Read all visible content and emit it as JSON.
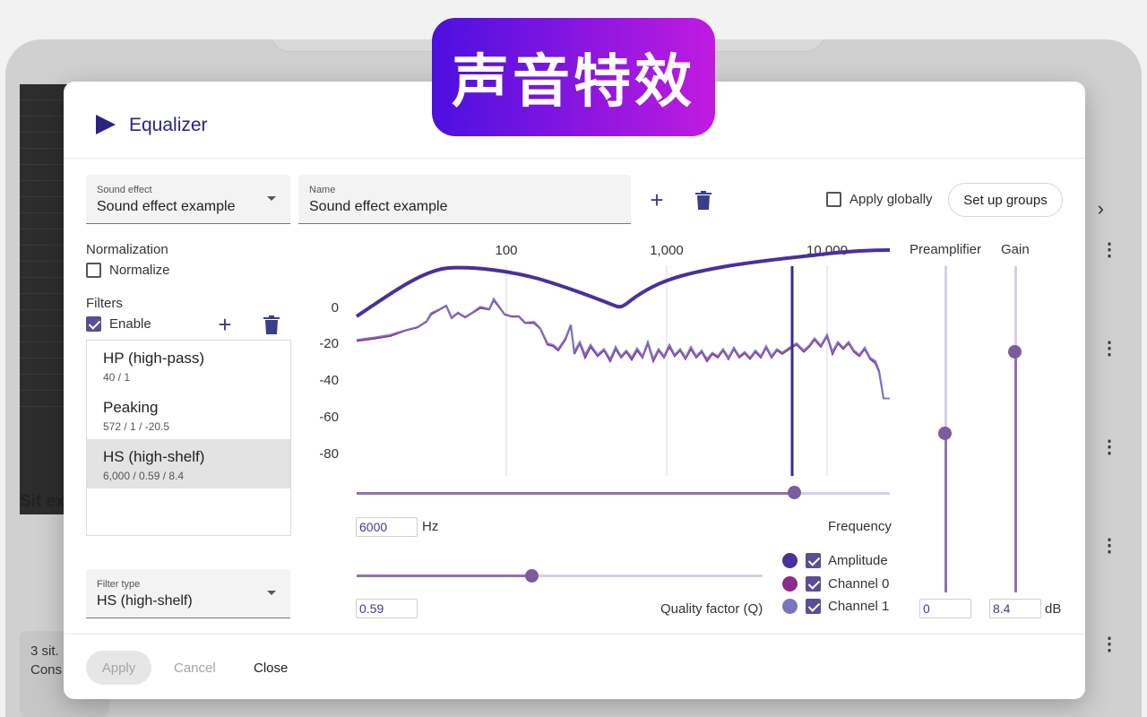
{
  "badge": "声音特效",
  "background": {
    "sit_text": "Sit ex",
    "card_line1": "3 sit.",
    "card_line2": "Cons"
  },
  "dialog": {
    "title": "Equalizer",
    "sound_effect": {
      "label": "Sound effect",
      "value": "Sound effect example"
    },
    "name_field": {
      "label": "Name",
      "value": "Sound effect example"
    },
    "apply_globally": {
      "label": "Apply globally",
      "checked": false
    },
    "setup_groups": "Set up groups",
    "normalization": {
      "heading": "Normalization",
      "label": "Normalize",
      "checked": false
    },
    "filters": {
      "heading": "Filters",
      "enable_label": "Enable",
      "enabled": true,
      "items": [
        {
          "name": "HP (high-pass)",
          "params": "40 / 1",
          "selected": false
        },
        {
          "name": "Peaking",
          "params": "572 / 1 / -20.5",
          "selected": false
        },
        {
          "name": "HS (high-shelf)",
          "params": "6,000 / 0.59 / 8.4",
          "selected": true
        }
      ]
    },
    "filter_type": {
      "label": "Filter type",
      "value": "HS (high-shelf)"
    },
    "frequency": {
      "value": "6000",
      "unit": "Hz",
      "label": "Frequency",
      "slider_fraction": 0.82
    },
    "quality": {
      "value": "0.59",
      "label": "Quality factor (Q)",
      "slider_fraction": 0.43
    },
    "legend": [
      {
        "label": "Amplitude",
        "color": "#4a2f9e",
        "checked": true
      },
      {
        "label": "Channel 0",
        "color": "#8e2a8a",
        "checked": true
      },
      {
        "label": "Channel 1",
        "color": "#7b74c2",
        "checked": true
      }
    ],
    "preamplifier": {
      "label": "Preamplifier",
      "value": "0",
      "level_fraction": 0.49
    },
    "gain": {
      "label": "Gain",
      "value": "8.4",
      "unit": "dB",
      "level_fraction": 0.74
    },
    "footer": {
      "apply": "Apply",
      "cancel": "Cancel",
      "close": "Close"
    }
  },
  "chart_data": {
    "type": "line",
    "x_scale": "log",
    "x_ticks": [
      "100",
      "1,000",
      "10,000"
    ],
    "y_ticks": [
      "0",
      "-20",
      "-40",
      "-60",
      "-80"
    ],
    "ylim": [
      -80,
      0
    ],
    "cursor_frequency": 6000,
    "series": [
      {
        "name": "Amplitude",
        "color": "#4a2f9e"
      },
      {
        "name": "Channel 0",
        "color": "#8e2a8a"
      },
      {
        "name": "Channel 1",
        "color": "#7b74c2"
      }
    ]
  }
}
